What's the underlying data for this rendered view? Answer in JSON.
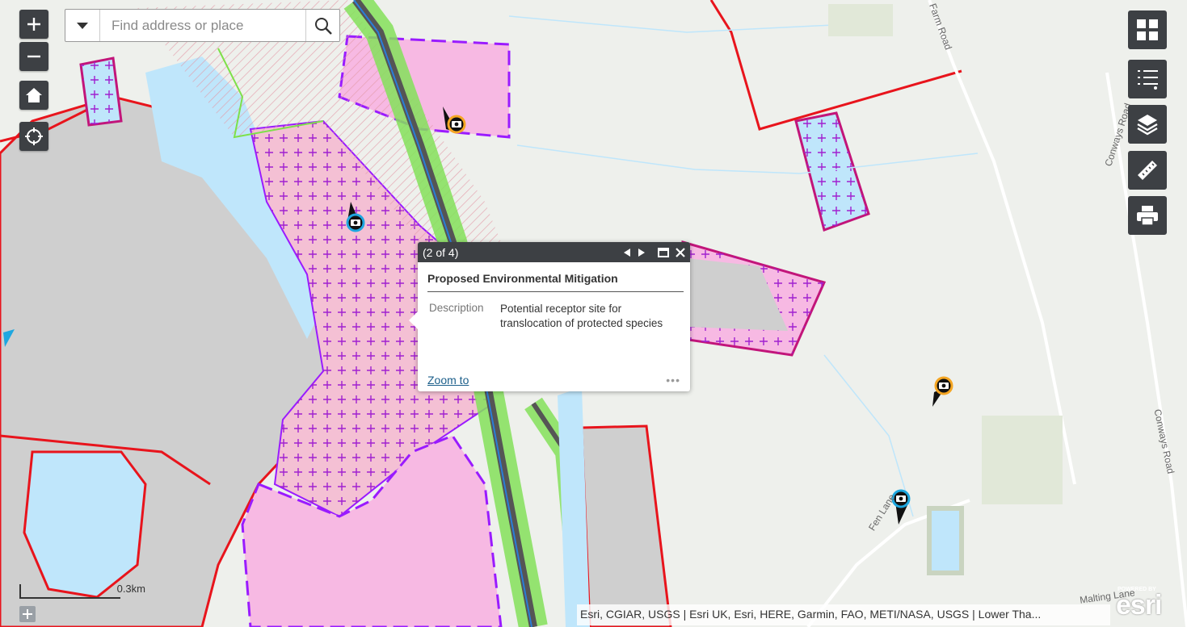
{
  "search": {
    "placeholder": "Find address or place"
  },
  "popup": {
    "count": "(2 of 4)",
    "title": "Proposed Environmental Mitigation",
    "field_label": "Description",
    "field_value": "Potential receptor site for translocation of protected species",
    "zoom_to": "Zoom to",
    "more": "•••"
  },
  "scale": {
    "label": "0.3km"
  },
  "attribution": "Esri, CGIAR, USGS | Esri UK, Esri, HERE, Garmin, FAO, METI/NASA, USGS | Lower Tha...",
  "esri_logo": {
    "powered": "POWERED BY",
    "text": "esri"
  },
  "map_labels": {
    "farm_road": "Farm Road",
    "conways_road_1": "Conways Road",
    "conways_road_2": "Conways Road",
    "fen_lane": "Fen Lane",
    "malting_lane": "Malting Lane"
  },
  "colors": {
    "button_bg": "#3d4044",
    "mitigation_fill": "#f7b9e3",
    "boundary_red": "#e8141c",
    "purple": "#9a1bff",
    "water": "#bfe6fb",
    "gray_area": "#cccccc"
  }
}
